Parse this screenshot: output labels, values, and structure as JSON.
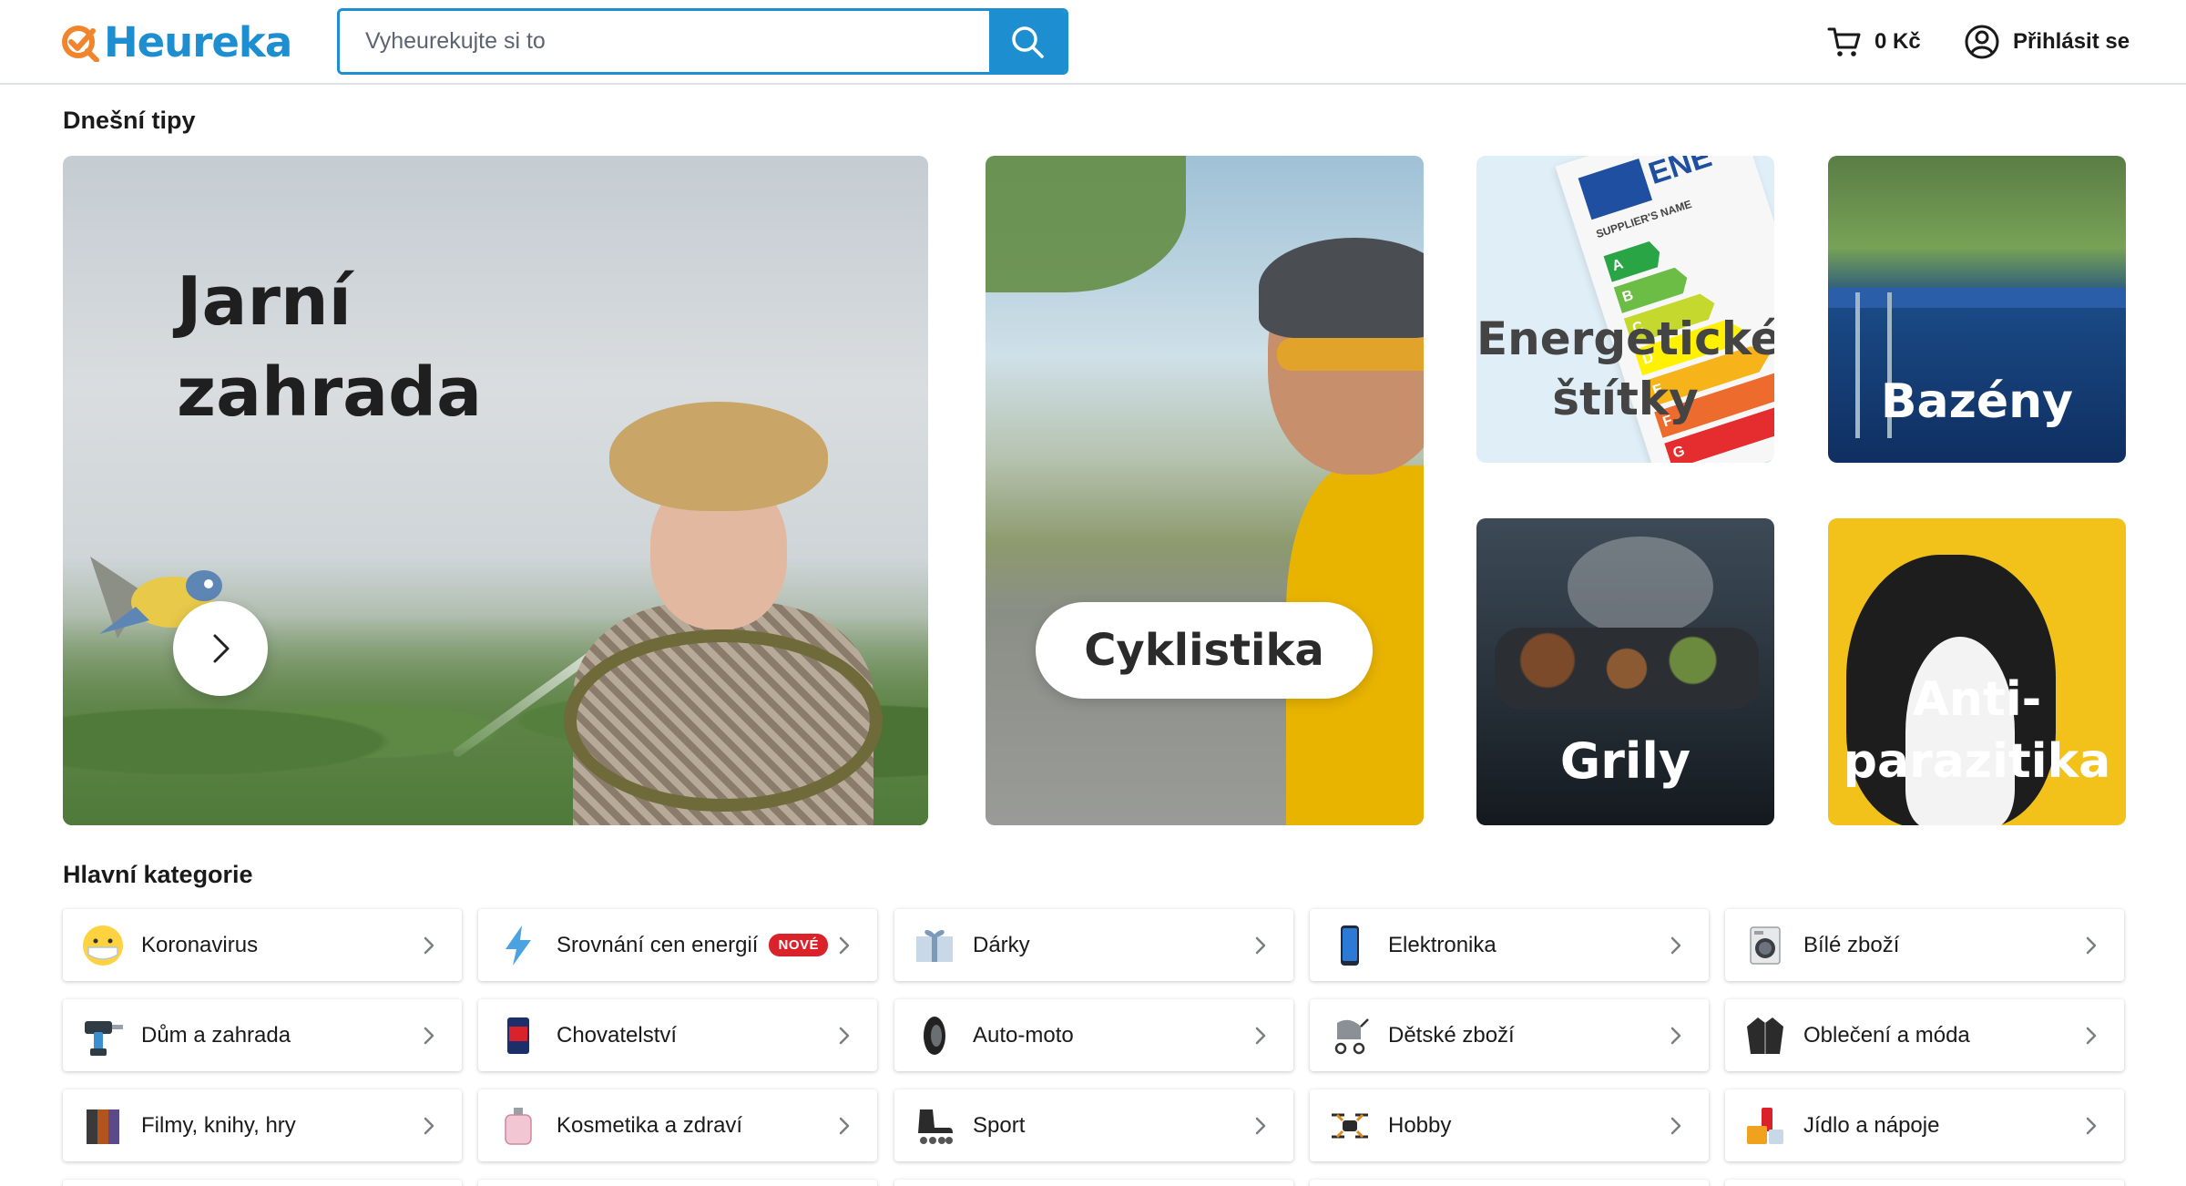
{
  "header": {
    "logo_text": "Heureka",
    "search_placeholder": "Vyheurekujte si to",
    "cart_label": "0 Kč",
    "login_label": "Přihlásit se"
  },
  "tips": {
    "title": "Dnešní tipy",
    "hero": {
      "label": "Jarní\nzahrada"
    },
    "cyclistics": {
      "label": "Cyklistika"
    },
    "energy": {
      "label": "Energetické\nštítky",
      "eu_label": "ENE",
      "supplier_label": "SUPPLIER'S NAME",
      "grades": [
        "A",
        "B",
        "C",
        "D",
        "E",
        "F",
        "G"
      ]
    },
    "pools": {
      "label": "Bazény"
    },
    "grills": {
      "label": "Grily"
    },
    "antiparasitic": {
      "label": "Anti-\nparazitika"
    }
  },
  "categories": {
    "title": "Hlavní kategorie",
    "new_badge": "NOVÉ",
    "items": [
      {
        "label": "Koronavirus",
        "icon": "face-mask-icon"
      },
      {
        "label": "Srovnání cen energií",
        "icon": "lightning-icon"
      },
      {
        "label": "Dárky",
        "icon": "gift-icon"
      },
      {
        "label": "Elektronika",
        "icon": "smartphone-icon"
      },
      {
        "label": "Bílé zboží",
        "icon": "washing-machine-icon"
      },
      {
        "label": "Dům a zahrada",
        "icon": "drill-icon"
      },
      {
        "label": "Chovatelství",
        "icon": "pet-food-icon"
      },
      {
        "label": "Auto-moto",
        "icon": "tire-icon"
      },
      {
        "label": "Dětské zboží",
        "icon": "stroller-icon"
      },
      {
        "label": "Oblečení a móda",
        "icon": "jacket-icon"
      },
      {
        "label": "Filmy, knihy, hry",
        "icon": "books-icon"
      },
      {
        "label": "Kosmetika a zdraví",
        "icon": "perfume-icon"
      },
      {
        "label": "Sport",
        "icon": "skate-icon"
      },
      {
        "label": "Hobby",
        "icon": "drone-icon"
      },
      {
        "label": "Jídlo a nápoje",
        "icon": "food-icon"
      }
    ]
  },
  "colors": {
    "brand_blue": "#1d8fd0",
    "brand_orange": "#f0852d",
    "badge_red": "#d9222a"
  }
}
